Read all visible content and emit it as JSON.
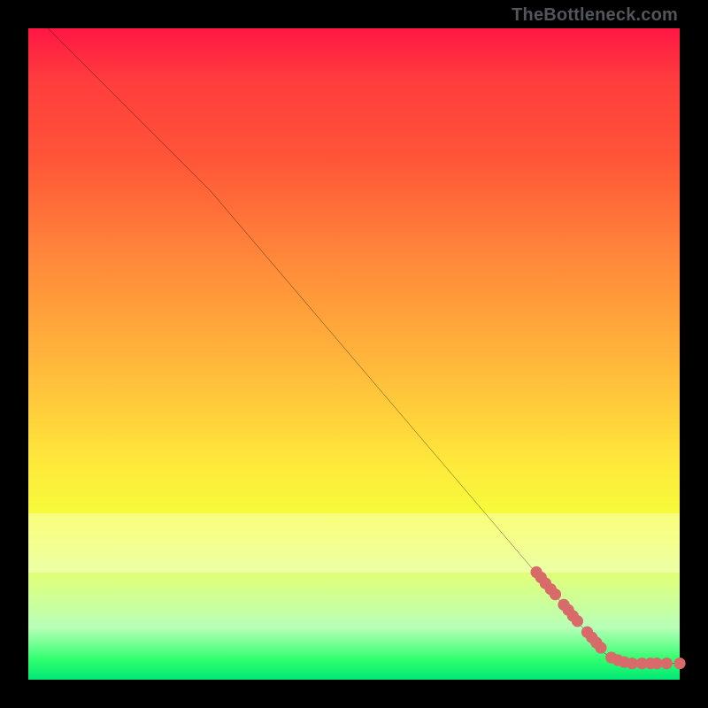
{
  "attribution": "TheBottleneck.com",
  "colors": {
    "frame": "#000000",
    "line": "#000000",
    "point": "#d86a6a",
    "grad_top": "#ff1744",
    "grad_bottom": "#00e676",
    "milk_band": "rgba(255,255,255,0.35)"
  },
  "overlay_bands": [
    {
      "top_pct": 74.5,
      "height_pct": 9.0
    }
  ],
  "chart_data": {
    "type": "line",
    "title": "",
    "xlabel": "",
    "ylabel": "",
    "xlim": [
      0,
      100
    ],
    "ylim": [
      0,
      100
    ],
    "series": [
      {
        "name": "curve",
        "kind": "line",
        "points": [
          {
            "x": 3.0,
            "y": 100.0
          },
          {
            "x": 28.0,
            "y": 75.0
          },
          {
            "x": 88.5,
            "y": 4.0
          },
          {
            "x": 92.5,
            "y": 2.5
          },
          {
            "x": 100.0,
            "y": 2.5
          }
        ]
      },
      {
        "name": "markers",
        "kind": "scatter",
        "points": [
          {
            "x": 78.0,
            "y": 16.5
          },
          {
            "x": 78.7,
            "y": 15.7
          },
          {
            "x": 79.4,
            "y": 14.8
          },
          {
            "x": 80.2,
            "y": 13.9
          },
          {
            "x": 80.9,
            "y": 13.1
          },
          {
            "x": 82.2,
            "y": 11.5
          },
          {
            "x": 82.9,
            "y": 10.7
          },
          {
            "x": 83.6,
            "y": 9.8
          },
          {
            "x": 84.3,
            "y": 9.0
          },
          {
            "x": 85.8,
            "y": 7.3
          },
          {
            "x": 86.5,
            "y": 6.5
          },
          {
            "x": 87.2,
            "y": 5.7
          },
          {
            "x": 87.9,
            "y": 4.9
          },
          {
            "x": 89.5,
            "y": 3.4
          },
          {
            "x": 90.5,
            "y": 3.0
          },
          {
            "x": 91.5,
            "y": 2.7
          },
          {
            "x": 92.7,
            "y": 2.5
          },
          {
            "x": 94.2,
            "y": 2.5
          },
          {
            "x": 95.5,
            "y": 2.5
          },
          {
            "x": 96.5,
            "y": 2.5
          },
          {
            "x": 98.0,
            "y": 2.5
          },
          {
            "x": 100.0,
            "y": 2.5
          }
        ]
      }
    ]
  }
}
